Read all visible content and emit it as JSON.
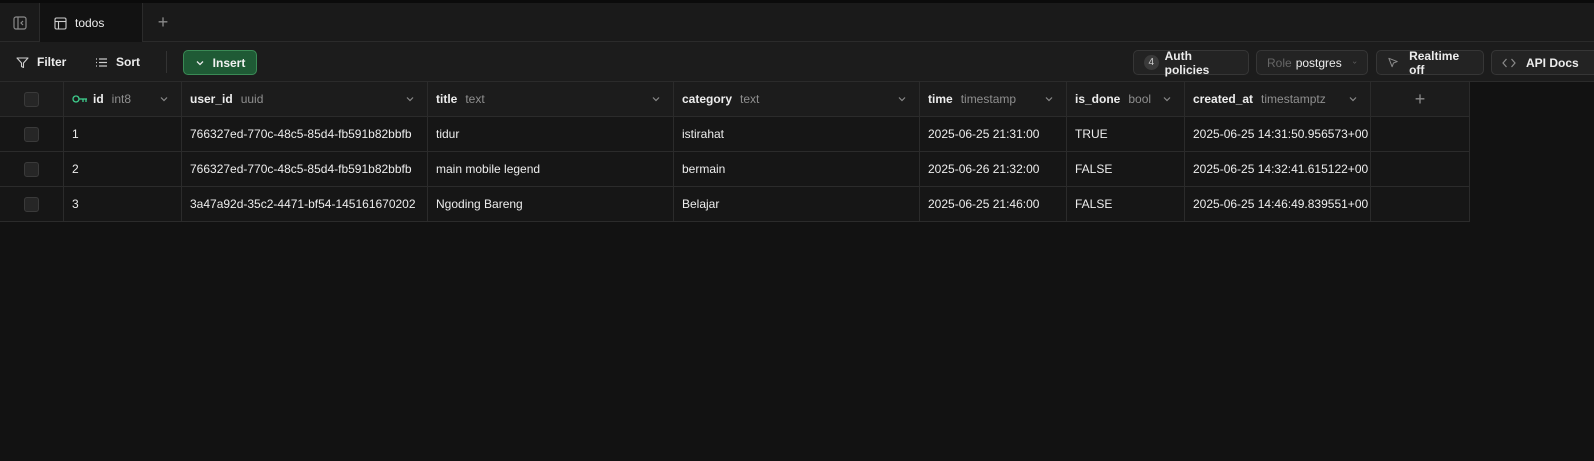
{
  "tabbar": {
    "tab_label": "todos",
    "add_symbol": "+"
  },
  "toolbar": {
    "filter_label": "Filter",
    "sort_label": "Sort",
    "insert_label": "Insert",
    "auth_count": "4",
    "auth_label": "Auth policies",
    "role_key": "Role",
    "role_value": "postgres",
    "realtime_label": "Realtime off",
    "api_label": "API Docs"
  },
  "columns": [
    {
      "name": "id",
      "type": "int8"
    },
    {
      "name": "user_id",
      "type": "uuid"
    },
    {
      "name": "title",
      "type": "text"
    },
    {
      "name": "category",
      "type": "text"
    },
    {
      "name": "time",
      "type": "timestamp"
    },
    {
      "name": "is_done",
      "type": "bool"
    },
    {
      "name": "created_at",
      "type": "timestamptz"
    }
  ],
  "add_column_symbol": "+",
  "rows": [
    {
      "id": "1",
      "user_id": "766327ed-770c-48c5-85d4-fb591b82bbfb",
      "title": "tidur",
      "category": "istirahat",
      "time": "2025-06-25 21:31:00",
      "is_done": "TRUE",
      "created_at": "2025-06-25 14:31:50.956573+00"
    },
    {
      "id": "2",
      "user_id": "766327ed-770c-48c5-85d4-fb591b82bbfb",
      "title": "main mobile legend",
      "category": "bermain",
      "time": "2025-06-26 21:32:00",
      "is_done": "FALSE",
      "created_at": "2025-06-25 14:32:41.615122+00"
    },
    {
      "id": "3",
      "user_id": "3a47a92d-35c2-4471-bf54-145161670202",
      "title": "Ngoding Bareng",
      "category": "Belajar",
      "time": "2025-06-25 21:46:00",
      "is_done": "FALSE",
      "created_at": "2025-06-25 14:46:49.839551+00"
    }
  ],
  "colors": {
    "background": "#121212",
    "insert_button": "#1f5a35",
    "primary_key_icon": "#3ecf8e"
  }
}
